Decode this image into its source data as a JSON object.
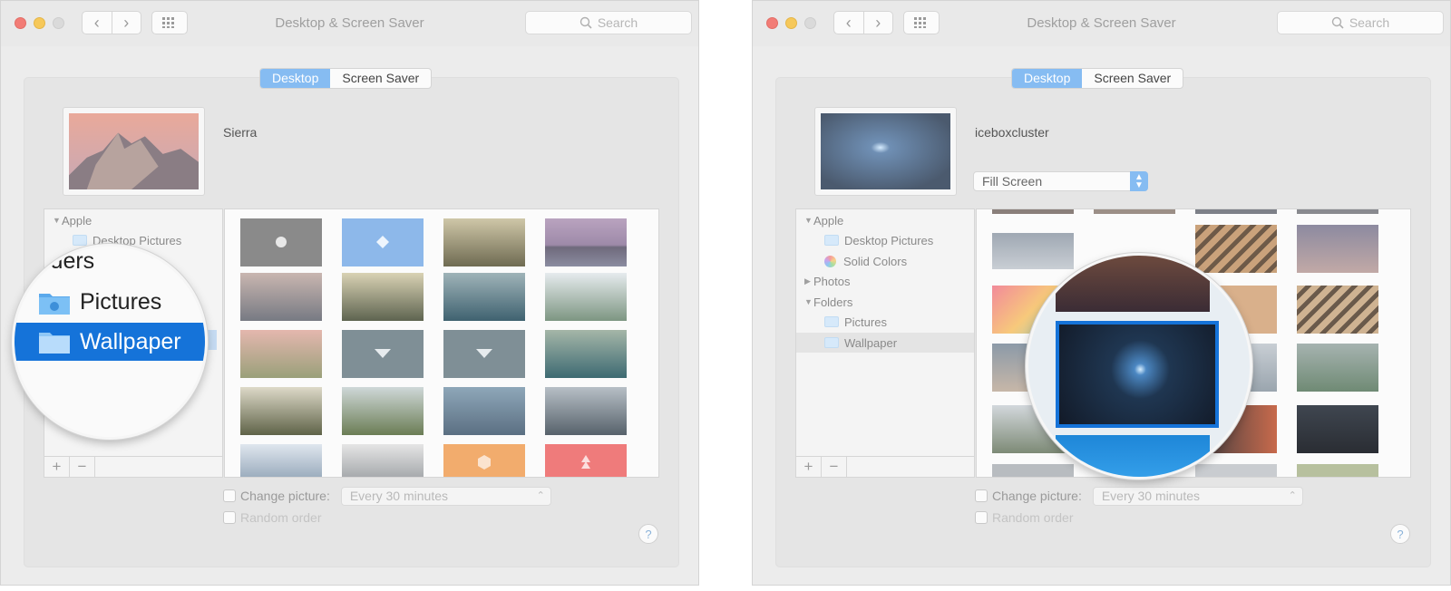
{
  "left": {
    "window_title": "Desktop & Screen Saver",
    "search_placeholder": "Search",
    "tabs": [
      {
        "label": "Desktop"
      },
      {
        "label": "Screen Saver"
      }
    ],
    "wallpaper_name": "Sierra",
    "sidebar": {
      "items": [
        {
          "label": "Apple"
        },
        {
          "label": "Desktop Pictures"
        }
      ]
    },
    "magnifier": {
      "heading_fragment": "lders",
      "items": [
        {
          "label": "Pictures"
        },
        {
          "label": "Wallpaper"
        }
      ]
    },
    "options": {
      "change_picture": "Change picture:",
      "interval": "Every 30 minutes",
      "random_order": "Random order"
    },
    "help": "?"
  },
  "right": {
    "window_title": "Desktop & Screen Saver",
    "search_placeholder": "Search",
    "tabs": [
      {
        "label": "Desktop"
      },
      {
        "label": "Screen Saver"
      }
    ],
    "wallpaper_name": "iceboxcluster",
    "fit_mode": "Fill Screen",
    "sidebar": {
      "items": [
        {
          "label": "Apple"
        },
        {
          "label": "Desktop Pictures"
        },
        {
          "label": "Solid Colors"
        },
        {
          "label": "Photos"
        },
        {
          "label": "Folders"
        },
        {
          "label": "Pictures"
        },
        {
          "label": "Wallpaper"
        }
      ]
    },
    "options": {
      "change_picture": "Change picture:",
      "interval": "Every 30 minutes",
      "random_order": "Random order"
    },
    "help": "?"
  },
  "icons": {
    "back": "‹",
    "forward": "›",
    "add": "+",
    "remove": "−",
    "disclosure_open": "▼",
    "disclosure_closed": "▶",
    "stepper": "⌃⌄"
  },
  "colors": {
    "accent": "#86bcf2",
    "selection": "#1573d9",
    "close": "#f27c76",
    "minimize": "#f6c85a"
  }
}
